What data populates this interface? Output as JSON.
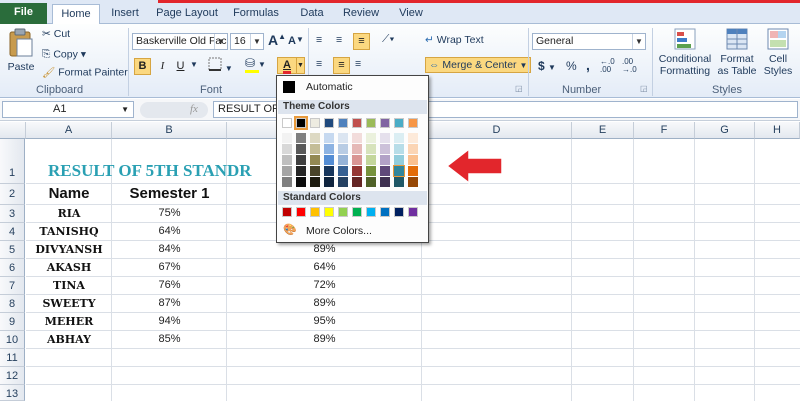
{
  "tabs": [
    "File",
    "Home",
    "Insert",
    "Page Layout",
    "Formulas",
    "Data",
    "Review",
    "View"
  ],
  "active_tab": "Home",
  "clipboard": {
    "paste": "Paste",
    "cut": "Cut",
    "copy": "Copy",
    "copy_dd": "▾",
    "format_painter": "Format Painter",
    "label": "Clipboard"
  },
  "font": {
    "name": "Baskerville Old Fac",
    "size": "16",
    "label": "Font",
    "grow": "A",
    "shrink": "A",
    "bold": "B",
    "italic": "I",
    "underline": "U",
    "fill_color": "#ffff00",
    "font_color": "#e2262c"
  },
  "alignment": {
    "wrap_text": "Wrap Text",
    "merge_center": "Merge & Center",
    "label": "Alignment"
  },
  "number": {
    "format": "General",
    "currency": "$",
    "percent": "%",
    "comma": ",",
    "label": "Number"
  },
  "styles": {
    "conditional_1": "Conditional",
    "conditional_2": "Formatting",
    "table_1": "Format",
    "table_2": "as Table",
    "cell_1": "Cell",
    "cell_2": "Styles",
    "label": "Styles"
  },
  "formula_bar": {
    "name_box": "A1",
    "fx": "fx",
    "content": "RESULT OF"
  },
  "columns": [
    "A",
    "B",
    "C",
    "D",
    "E",
    "F",
    "G",
    "H"
  ],
  "rows": [
    "1",
    "2",
    "3",
    "4",
    "5",
    "6",
    "7",
    "8",
    "9",
    "10",
    "11",
    "12",
    "13"
  ],
  "sheet": {
    "title": "RESULT OF 5TH STANDR",
    "header_name": "Name",
    "header_sem1": "Semester 1",
    "students": [
      {
        "name": "RIA",
        "sem1": "75%",
        "sem2": ""
      },
      {
        "name": "TANISHQ",
        "sem1": "64%",
        "sem2": ""
      },
      {
        "name": "DIVYANSH",
        "sem1": "84%",
        "sem2": "89%"
      },
      {
        "name": "AKASH",
        "sem1": "67%",
        "sem2": "64%"
      },
      {
        "name": "TINA",
        "sem1": "76%",
        "sem2": "72%"
      },
      {
        "name": "SWEETY",
        "sem1": "87%",
        "sem2": "89%"
      },
      {
        "name": "MEHER",
        "sem1": "94%",
        "sem2": "95%"
      },
      {
        "name": "ABHAY",
        "sem1": "85%",
        "sem2": "89%"
      }
    ]
  },
  "color_menu": {
    "automatic": "Automatic",
    "theme_colors": "Theme Colors",
    "standard_colors": "Standard Colors",
    "more_colors": "More Colors...",
    "theme_top": [
      "#ffffff",
      "#000000",
      "#eeece1",
      "#1f497d",
      "#4f81bd",
      "#c0504d",
      "#9bbb59",
      "#8064a2",
      "#4bacc6",
      "#f79646"
    ],
    "theme_shades": [
      [
        "#f2f2f2",
        "#d8d8d8",
        "#bfbfbf",
        "#a5a5a5",
        "#7f7f7f"
      ],
      [
        "#7f7f7f",
        "#595959",
        "#3f3f3f",
        "#262626",
        "#0c0c0c"
      ],
      [
        "#ddd9c3",
        "#c4bd97",
        "#938953",
        "#494429",
        "#1d1b10"
      ],
      [
        "#c6d9f0",
        "#8db3e2",
        "#548dd4",
        "#17365d",
        "#0f243e"
      ],
      [
        "#dbe5f1",
        "#b8cce4",
        "#95b3d7",
        "#366092",
        "#244061"
      ],
      [
        "#f2dcdb",
        "#e5b9b7",
        "#d99694",
        "#953734",
        "#632423"
      ],
      [
        "#ebf1dd",
        "#d7e3bc",
        "#c3d69b",
        "#76923c",
        "#4f6128"
      ],
      [
        "#e5e0ec",
        "#ccc1d9",
        "#b2a2c7",
        "#5f497a",
        "#3f3151"
      ],
      [
        "#dbeef3",
        "#b7dde8",
        "#92cddc",
        "#31859b",
        "#205867"
      ],
      [
        "#fdeada",
        "#fbd5b5",
        "#fac08f",
        "#e36c09",
        "#974806"
      ]
    ],
    "standard": [
      "#c00000",
      "#ff0000",
      "#ffc000",
      "#ffff00",
      "#92d050",
      "#00b050",
      "#00b0f0",
      "#0070c0",
      "#002060",
      "#7030a0"
    ],
    "arrow_color": "#e2262c"
  }
}
